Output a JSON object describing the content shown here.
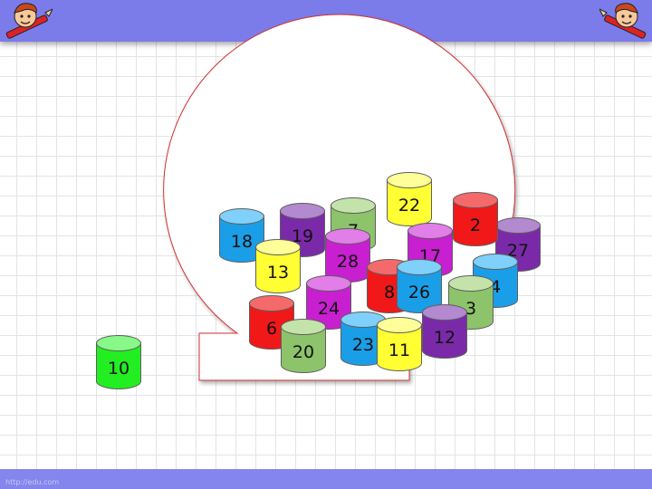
{
  "header": {
    "left_icon": "boy-pencil-icon",
    "right_icon": "boy-pencil-icon"
  },
  "footer": {
    "watermark": "http://edu.com"
  },
  "colors": {
    "header_bar": "#7b7bea",
    "bag_outline": "#d03030",
    "blue": "#1a9ee8",
    "purple": "#7a2aa8",
    "sage": "#8dc36a",
    "yellow": "#ffff33",
    "red": "#f01818",
    "magenta": "#c81fd0",
    "green": "#22ee22"
  },
  "outside_jar": {
    "number": "10",
    "color": "green"
  },
  "bag_jars": [
    {
      "number": "27",
      "color": "purple"
    },
    {
      "number": "22",
      "color": "yellow"
    },
    {
      "number": "7",
      "color": "sage"
    },
    {
      "number": "19",
      "color": "purple"
    },
    {
      "number": "2",
      "color": "red"
    },
    {
      "number": "18",
      "color": "blue"
    },
    {
      "number": "17",
      "color": "magenta"
    },
    {
      "number": "28",
      "color": "magenta"
    },
    {
      "number": "13",
      "color": "yellow"
    },
    {
      "number": "4",
      "color": "blue"
    },
    {
      "number": "8",
      "color": "red"
    },
    {
      "number": "26",
      "color": "blue"
    },
    {
      "number": "24",
      "color": "magenta"
    },
    {
      "number": "3",
      "color": "sage"
    },
    {
      "number": "12",
      "color": "purple"
    },
    {
      "number": "6",
      "color": "red"
    },
    {
      "number": "20",
      "color": "sage"
    },
    {
      "number": "23",
      "color": "blue"
    },
    {
      "number": "11",
      "color": "yellow"
    }
  ]
}
